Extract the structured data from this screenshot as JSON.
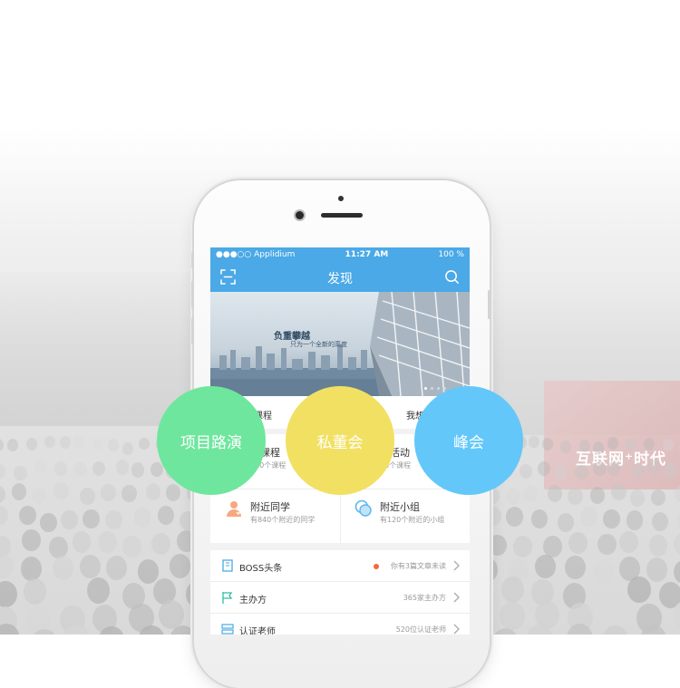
{
  "status_bar": {
    "carrier": "●●●○○ Applidium",
    "time": "11:27 AM",
    "battery": "100 %"
  },
  "navbar": {
    "title": "发现",
    "left_icon": "scan-icon",
    "right_icon": "search-icon"
  },
  "banner": {
    "slogan_main": "负重攀越",
    "slogan_sub": "只为一个全新的高度"
  },
  "tabs": [
    {
      "label": "课程"
    },
    {
      "label": "我想"
    }
  ],
  "grid": [
    {
      "title": "近课程",
      "subtitle": "420个课程"
    },
    {
      "title": "近活动",
      "subtitle": "83个课程"
    },
    {
      "title": "附近同学",
      "subtitle": "有840个附近的同学"
    },
    {
      "title": "附近小组",
      "subtitle": "有120个附近的小组"
    }
  ],
  "list": [
    {
      "title": "BOSS头条",
      "value": "你有3篇文章未读",
      "icon": "book-icon"
    },
    {
      "title": "主办方",
      "value": "365家主办方",
      "icon": "flag-icon"
    },
    {
      "title": "认证老师",
      "value": "520位认证老师",
      "icon": "certificate-icon"
    }
  ],
  "circles": [
    {
      "label": "项目路演",
      "color": "#6fe69e"
    },
    {
      "label": "私董会",
      "color": "#f2e062"
    },
    {
      "label": "峰会",
      "color": "#63c7fa"
    }
  ],
  "background": {
    "banner_text": "互联网⁺时代"
  },
  "accent_color": "#4aa9e6"
}
